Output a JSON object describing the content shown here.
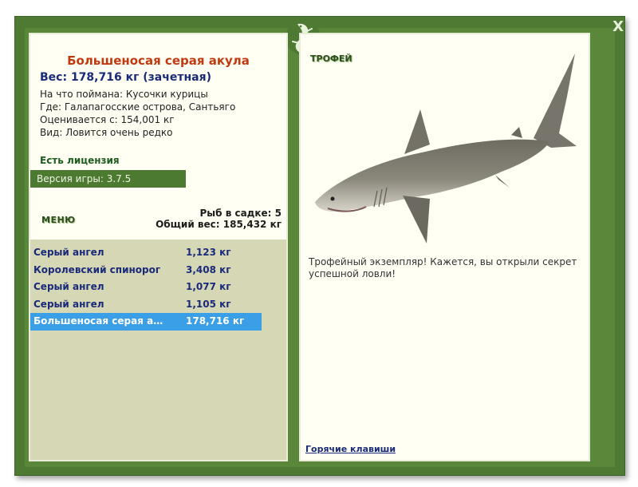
{
  "window": {
    "close_label": "X"
  },
  "fish": {
    "title": "Большеносая серая акула",
    "weight_line": "Вес: 178,716 кг (зачетная)",
    "bait_line": "На что поймана: Кусочки курицы",
    "place_line": "Где: Галапагосские острова, Сантьяго",
    "value_line": "Оценивается с: 154,001 кг",
    "rarity_line": "Вид: Ловится очень редко"
  },
  "license_label": "Есть лицензия",
  "version_label": "Версия игры: 3.7.5",
  "menu_label": "МЕНЮ",
  "stats": {
    "in_cage": "Рыб в садке: 5",
    "total_weight": "Общий вес: 185,432 кг"
  },
  "catch_list": [
    {
      "name": "Серый ангел",
      "weight": "1,123 кг"
    },
    {
      "name": "Королевский спинорог",
      "weight": "3,408 кг"
    },
    {
      "name": "Серый ангел",
      "weight": "1,077 кг"
    },
    {
      "name": "Серый ангел",
      "weight": "1,105 кг"
    },
    {
      "name": "Большеносая серая ак...",
      "weight": "178,716 кг"
    }
  ],
  "trophy_label": "ТРОФЕЙ",
  "trophy_message": "Трофейный экземпляр! Кажется, вы открыли секрет успешной ловли!",
  "hotkeys_label": "Горячие клавиши"
}
